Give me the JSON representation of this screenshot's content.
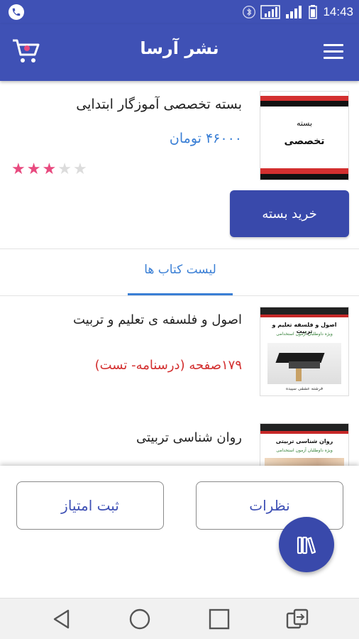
{
  "status_bar": {
    "time": "14:43",
    "icons": [
      "phone-call-icon",
      "bluetooth-icon",
      "signal-icon",
      "signal-icon-2",
      "battery-icon"
    ]
  },
  "app_bar": {
    "title": "نشر آرسا",
    "left_icon": "cart-icon",
    "right_icon": "menu-icon"
  },
  "package": {
    "title": "بسته تخصصی آموزگار ابتدایی",
    "price": "۴۶۰۰۰ تومان",
    "rating": 3,
    "rating_max": 5,
    "cover": {
      "line1": "بسته",
      "line2": "تخصصی"
    },
    "buy_label": "خرید بسته"
  },
  "tabs": {
    "active_label": "لیست کتاب ها"
  },
  "books": [
    {
      "title": "اصول و فلسفه ی تعلیم و تربیت",
      "pages": "۱۷۹صفحه (درسنامه- تست)",
      "cover_title": "اصول و فلسفه تعلیم و تربیت",
      "cover_subtitle": "ویژه داوطلبان آزمون استخدامی",
      "cover_author": "فرشته عشقی سپیده"
    },
    {
      "title": "روان شناسی تربیتی",
      "cover_title": "روان شناسی تربیتی",
      "cover_subtitle": "ویژه داوطلبان آزمون استخدامی"
    }
  ],
  "actions": {
    "comments_label": "نظرات",
    "rate_label": "ثبت امتیاز",
    "fab_icon": "library-books-icon"
  },
  "nav": {
    "icons": [
      "back-icon",
      "home-icon",
      "recents-icon",
      "switch-sim-icon"
    ]
  },
  "colors": {
    "primary": "#3f51b5",
    "button": "#3949ab",
    "price_blue": "#3a7fd5",
    "pages_red": "#d32f2f",
    "star_on": "#e84a7f",
    "star_off": "#dcdcdc"
  }
}
